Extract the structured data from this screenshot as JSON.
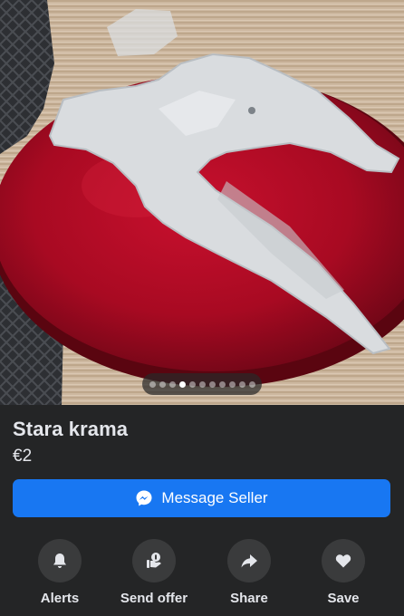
{
  "listing": {
    "title": "Stara krama",
    "price": "€2",
    "photo": {
      "dot_count": 11,
      "active_dot_index": 3
    }
  },
  "message_button": {
    "label": "Message Seller",
    "icon": "messenger-icon"
  },
  "actions": [
    {
      "label": "Alerts",
      "icon": "bell-icon"
    },
    {
      "label": "Send offer",
      "icon": "send-offer-icon"
    },
    {
      "label": "Share",
      "icon": "share-arrow-icon"
    },
    {
      "label": "Save",
      "icon": "heart-icon"
    }
  ],
  "colors": {
    "background": "#242526",
    "accent": "#1877f2",
    "action_circle": "#3a3b3c",
    "text": "#e4e6eb"
  }
}
